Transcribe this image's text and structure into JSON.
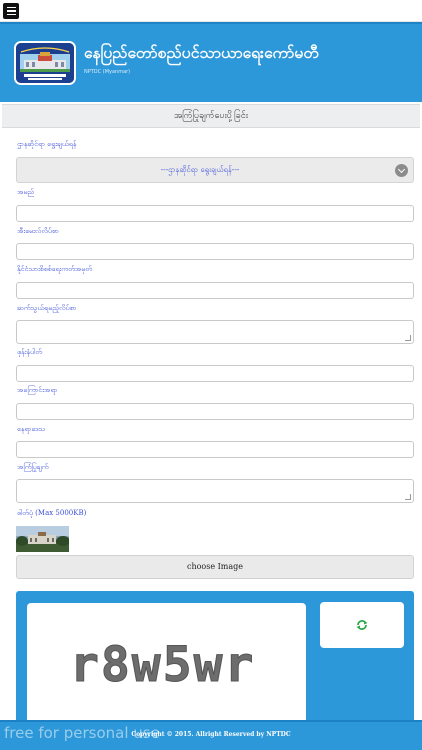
{
  "header": {
    "menu_icon": "hamburger-icon",
    "title": "နေပြည်တော်စည်ပင်သာယာရေးကော်မတီ",
    "subtitle": "NPTDC (Myanmar)",
    "logo_icon": "city-hall-logo"
  },
  "page": {
    "title": "အကြံပြုချက်ပေးပို့ခြင်း"
  },
  "form": {
    "department_label": "ဌာနဆိုင်ရာ ရွေးချယ်ရန်",
    "department_selected": "---ဌာနဆိုင်ရာ ရွေးချယ်ရန်---",
    "name_label": "အမည်",
    "email_label": "အီးမေးလ်လိပ်စာ",
    "nrc_label": "နိုင်ငံသားစိစစ်ရေးကတ်အမှတ်",
    "address_label": "ဆက်သွယ်ရမည့်လိပ်စာ",
    "phone_label": "ဖုန်းနံပါတ်",
    "subject_label": "အကြောင်းအရာ",
    "location_label": "နေရာဒေသ",
    "message_label": "အကြံပြုချက်",
    "photo_label": "ဓါတ်ပုံ (Max 5000KB)",
    "choose_image": "choose Image"
  },
  "captcha": {
    "text": "r8w5wr",
    "refresh_icon": "refresh-icon"
  },
  "footer": {
    "copyright": "Copyright © 2015. Allright Reserved by NPTDC",
    "watermark": "free for personal use"
  },
  "colors": {
    "header_blue": "#2d98d9",
    "label_blue": "#3a4fd8",
    "refresh_green": "#2ea84a"
  }
}
